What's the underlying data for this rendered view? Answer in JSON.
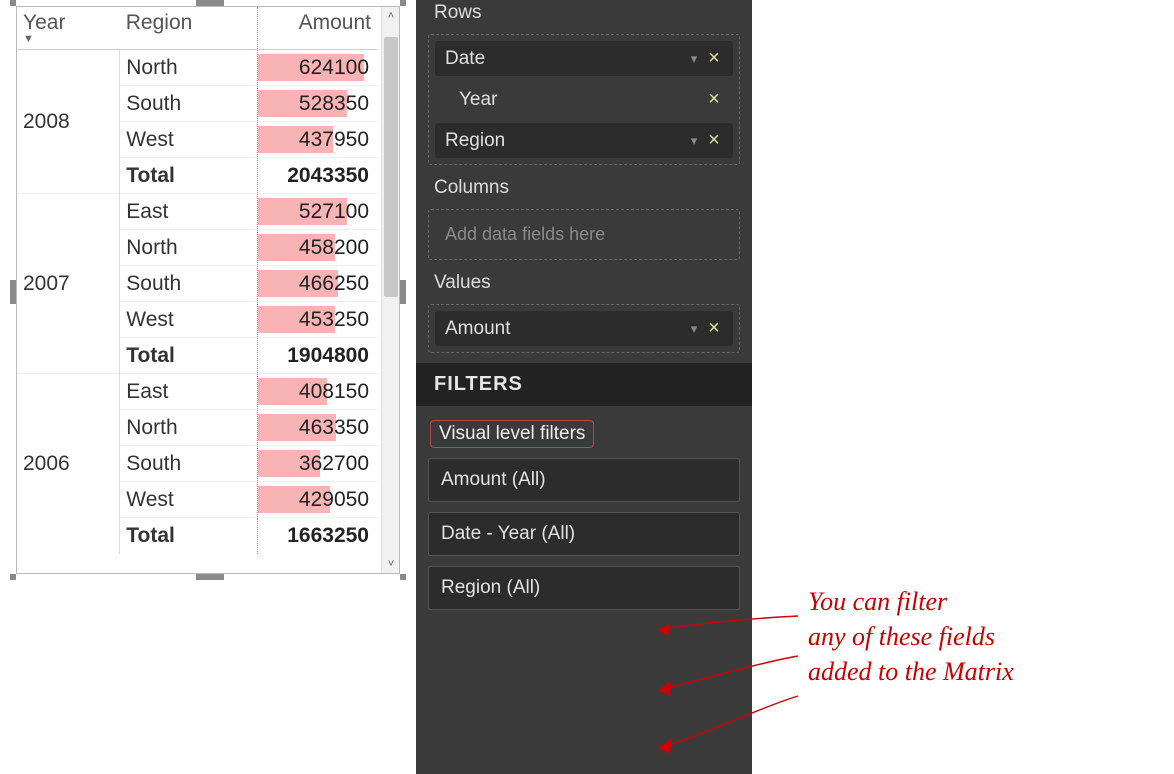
{
  "matrix": {
    "headers": {
      "year": "Year",
      "region": "Region",
      "amount": "Amount"
    },
    "sort_indicator": "▼",
    "max_amount": 700000,
    "groups": [
      {
        "year": "2008",
        "rows": [
          {
            "region": "North",
            "amount": 624100
          },
          {
            "region": "South",
            "amount": 528350
          },
          {
            "region": "West",
            "amount": 437950
          }
        ],
        "total_label": "Total",
        "total": 2043350
      },
      {
        "year": "2007",
        "rows": [
          {
            "region": "East",
            "amount": 527100
          },
          {
            "region": "North",
            "amount": 458200
          },
          {
            "region": "South",
            "amount": 466250
          },
          {
            "region": "West",
            "amount": 453250
          }
        ],
        "total_label": "Total",
        "total": 1904800
      },
      {
        "year": "2006",
        "rows": [
          {
            "region": "East",
            "amount": 408150
          },
          {
            "region": "North",
            "amount": 463350
          },
          {
            "region": "South",
            "amount": 362700
          },
          {
            "region": "West",
            "amount": 429050
          }
        ],
        "total_label": "Total",
        "total": 1663250
      }
    ]
  },
  "panel": {
    "rows_label": "Rows",
    "rows_fields": {
      "date_label": "Date",
      "year_label": "Year",
      "region_label": "Region"
    },
    "columns_label": "Columns",
    "columns_placeholder": "Add data fields here",
    "values_label": "Values",
    "values_field": "Amount",
    "filters_header": "FILTERS",
    "vlf_label": "Visual level filters",
    "filters": [
      {
        "label": "Amount  (All)"
      },
      {
        "label": "Date - Year  (All)"
      },
      {
        "label": "Region  (All)"
      }
    ]
  },
  "annotation": {
    "line1": "You can filter",
    "line2": "any of these fields",
    "line3": "added to the Matrix"
  },
  "glyphs": {
    "chevron_down": "▾",
    "close": "×",
    "scroll_up": "˄",
    "scroll_down": "˅"
  }
}
